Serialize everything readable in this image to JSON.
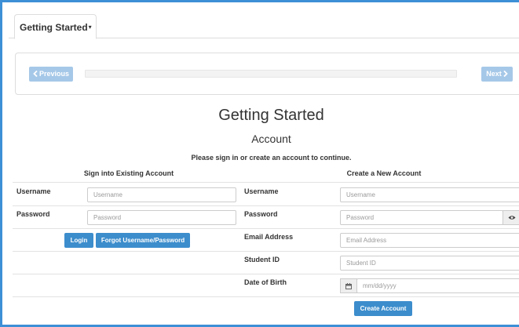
{
  "tabs": [
    {
      "label": "Getting Started",
      "caret": "▾"
    }
  ],
  "wizard": {
    "previous_label": "Previous",
    "next_label": "Next",
    "progress": 0
  },
  "page": {
    "title": "Getting Started",
    "subtitle": "Account",
    "instruction": "Please sign in or create an account to continue."
  },
  "signin": {
    "heading": "Sign into Existing Account",
    "username_label": "Username",
    "username_placeholder": "Username",
    "password_label": "Password",
    "password_placeholder": "Password",
    "login_label": "Login",
    "forgot_label": "Forgot Username/Password"
  },
  "create": {
    "heading": "Create a New Account",
    "username_label": "Username",
    "username_placeholder": "Username",
    "password_label": "Password",
    "password_placeholder": "Password",
    "email_label": "Email Address",
    "email_placeholder": "Email Address",
    "student_id_label": "Student ID",
    "student_id_placeholder": "Student ID",
    "dob_label": "Date of Birth",
    "dob_placeholder": "mm/dd/yyyy",
    "create_label": "Create Account"
  },
  "icons": {
    "prev": "chevron-left-icon",
    "next": "chevron-right-icon",
    "eye": "eye-icon",
    "calendar": "calendar-icon"
  },
  "colors": {
    "accent": "#3d8fd6",
    "primary_button": "#3c8dcc",
    "disabled_button": "#a6c8e8"
  }
}
